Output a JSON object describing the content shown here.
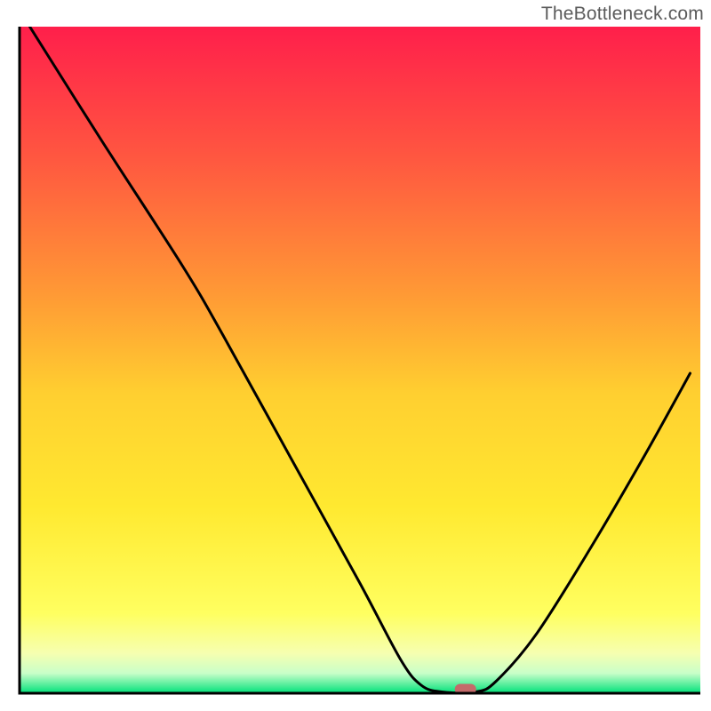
{
  "watermark": "TheBottleneck.com",
  "chart_data": {
    "type": "line",
    "title": "",
    "xlabel": "",
    "ylabel": "",
    "xlim": [
      0,
      100
    ],
    "ylim": [
      0,
      100
    ],
    "grid": false,
    "legend": false,
    "background_gradient": {
      "stops": [
        {
          "offset": 0.0,
          "color": "#ff1f4b"
        },
        {
          "offset": 0.2,
          "color": "#ff5840"
        },
        {
          "offset": 0.4,
          "color": "#ff9935"
        },
        {
          "offset": 0.55,
          "color": "#ffcf30"
        },
        {
          "offset": 0.72,
          "color": "#ffe930"
        },
        {
          "offset": 0.88,
          "color": "#ffff60"
        },
        {
          "offset": 0.94,
          "color": "#f6ffb0"
        },
        {
          "offset": 0.97,
          "color": "#c9ffc9"
        },
        {
          "offset": 1.0,
          "color": "#00e17a"
        }
      ]
    },
    "series": [
      {
        "name": "bottleneck-curve",
        "color": "#000000",
        "type": "curve",
        "points": [
          {
            "x": 1.5,
            "y": 100.0
          },
          {
            "x": 12.0,
            "y": 83.0
          },
          {
            "x": 24.0,
            "y": 64.0
          },
          {
            "x": 30.0,
            "y": 53.5
          },
          {
            "x": 40.0,
            "y": 35.0
          },
          {
            "x": 50.0,
            "y": 16.5
          },
          {
            "x": 56.0,
            "y": 5.0
          },
          {
            "x": 59.0,
            "y": 1.2
          },
          {
            "x": 62.0,
            "y": 0.2
          },
          {
            "x": 67.0,
            "y": 0.2
          },
          {
            "x": 70.0,
            "y": 1.8
          },
          {
            "x": 76.0,
            "y": 9.0
          },
          {
            "x": 84.0,
            "y": 22.0
          },
          {
            "x": 92.0,
            "y": 36.0
          },
          {
            "x": 98.5,
            "y": 48.0
          }
        ]
      }
    ],
    "marker": {
      "x": 65.5,
      "y": 0.6,
      "color": "#c46a6a",
      "shape": "capsule"
    },
    "axes": {
      "color": "#000000",
      "thickness": 3
    }
  }
}
